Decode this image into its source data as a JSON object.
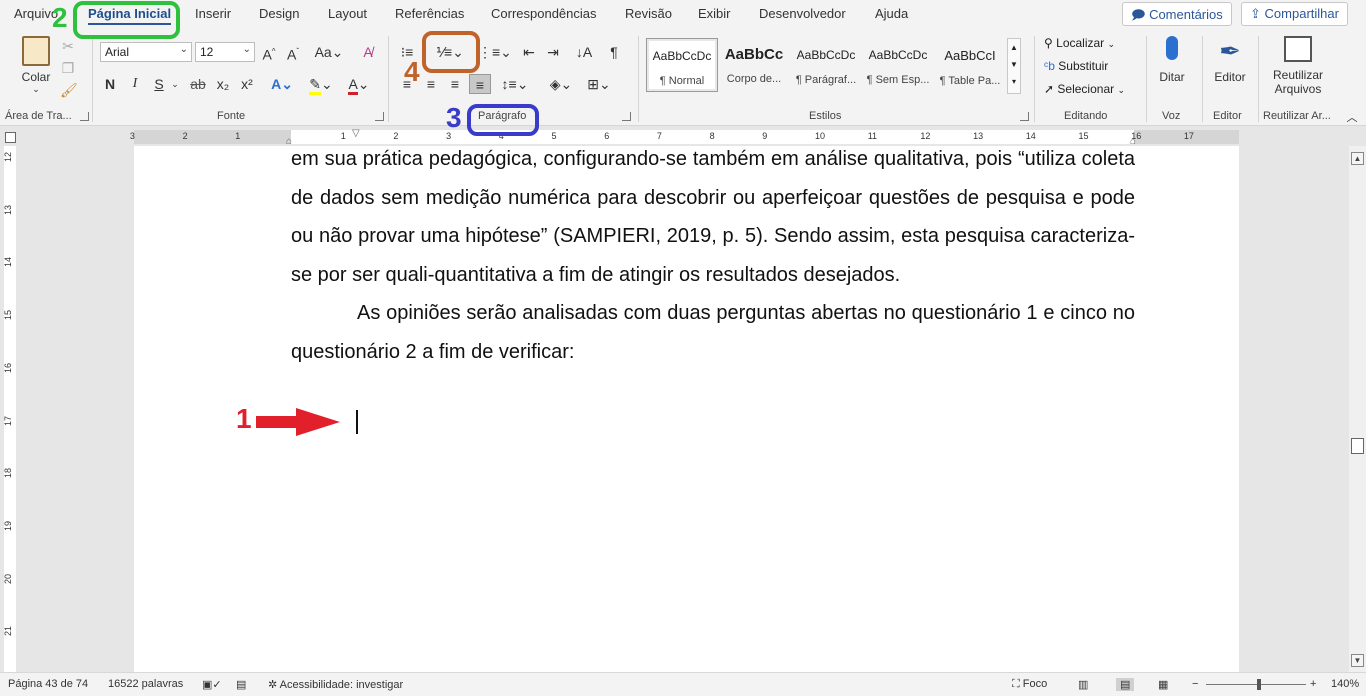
{
  "tabs": [
    "Arquivo",
    "Página Inicial",
    "Inserir",
    "Design",
    "Layout",
    "Referências",
    "Correspondências",
    "Revisão",
    "Exibir",
    "Desenvolvedor",
    "Ajuda"
  ],
  "top_buttons": {
    "comments": "Comentários",
    "share": "Compartilhar"
  },
  "ribbon": {
    "clipboard": {
      "paste": "Colar",
      "label": "Área de Tra..."
    },
    "font": {
      "name": "Arial",
      "size": "12",
      "bold": "N",
      "italic": "I",
      "underline": "S",
      "strike": "ab",
      "sub": "x₂",
      "sup": "x²",
      "case": "Aa",
      "grow": "A^",
      "shrink": "Aˇ",
      "label": "Fonte"
    },
    "paragraph": {
      "label": "Parágrafo"
    },
    "styles": {
      "items": [
        {
          "preview": "AaBbCcDc",
          "name": "¶ Normal"
        },
        {
          "preview": "AaBbCc",
          "name": "Corpo de..."
        },
        {
          "preview": "AaBbCcDc",
          "name": "¶ Parágraf..."
        },
        {
          "preview": "AaBbCcDc",
          "name": "¶ Sem Esp..."
        },
        {
          "preview": "AaBbCcI",
          "name": "¶ Table Pa..."
        }
      ],
      "label": "Estilos"
    },
    "editing": {
      "find": "Localizar",
      "replace": "Substituir",
      "select": "Selecionar",
      "label": "Editando"
    },
    "voice": {
      "dictate": "Ditar",
      "label": "Voz"
    },
    "editor": {
      "editor": "Editor",
      "label": "Editor"
    },
    "reuse": {
      "line1": "Reutilizar",
      "line2": "Arquivos",
      "label": "Reutilizar Ar..."
    }
  },
  "ruler": {
    "numbers": [
      "3",
      "2",
      "1",
      "1",
      "2",
      "3",
      "4",
      "5",
      "6",
      "7",
      "8",
      "9",
      "10",
      "11",
      "12",
      "13",
      "14",
      "15",
      "16",
      "17"
    ]
  },
  "vruler": {
    "numbers": [
      "12",
      "13",
      "14",
      "15",
      "16",
      "17",
      "18",
      "19",
      "20",
      "21"
    ]
  },
  "document": {
    "p1": "em sua prática pedagógica, configurando-se também em análise qualitativa, pois “utiliza coleta de dados sem medição numérica para descobrir ou aperfeiçoar questões de pesquisa e pode ou não provar uma hipótese” (SAMPIERI, 2019, p. 5). Sendo assim, esta pesquisa caracteriza-se por ser quali-quantitativa a fim de atingir os resultados desejados.",
    "p2": "As opiniões serão analisadas com duas perguntas abertas no questionário 1 e cinco no questionário 2 a fim de verificar:"
  },
  "status": {
    "page": "Página 43 de 74",
    "words": "16522 palavras",
    "accessibility": "Acessibilidade: investigar",
    "focus": "Foco",
    "zoom": "140%"
  },
  "annotations": {
    "n1": "1",
    "n2": "2",
    "n3": "3",
    "n4": "4"
  },
  "colors": {
    "green": "#2fc13d",
    "blue": "#3a3cc9",
    "orange": "#c0622a",
    "red": "#e2202b"
  }
}
